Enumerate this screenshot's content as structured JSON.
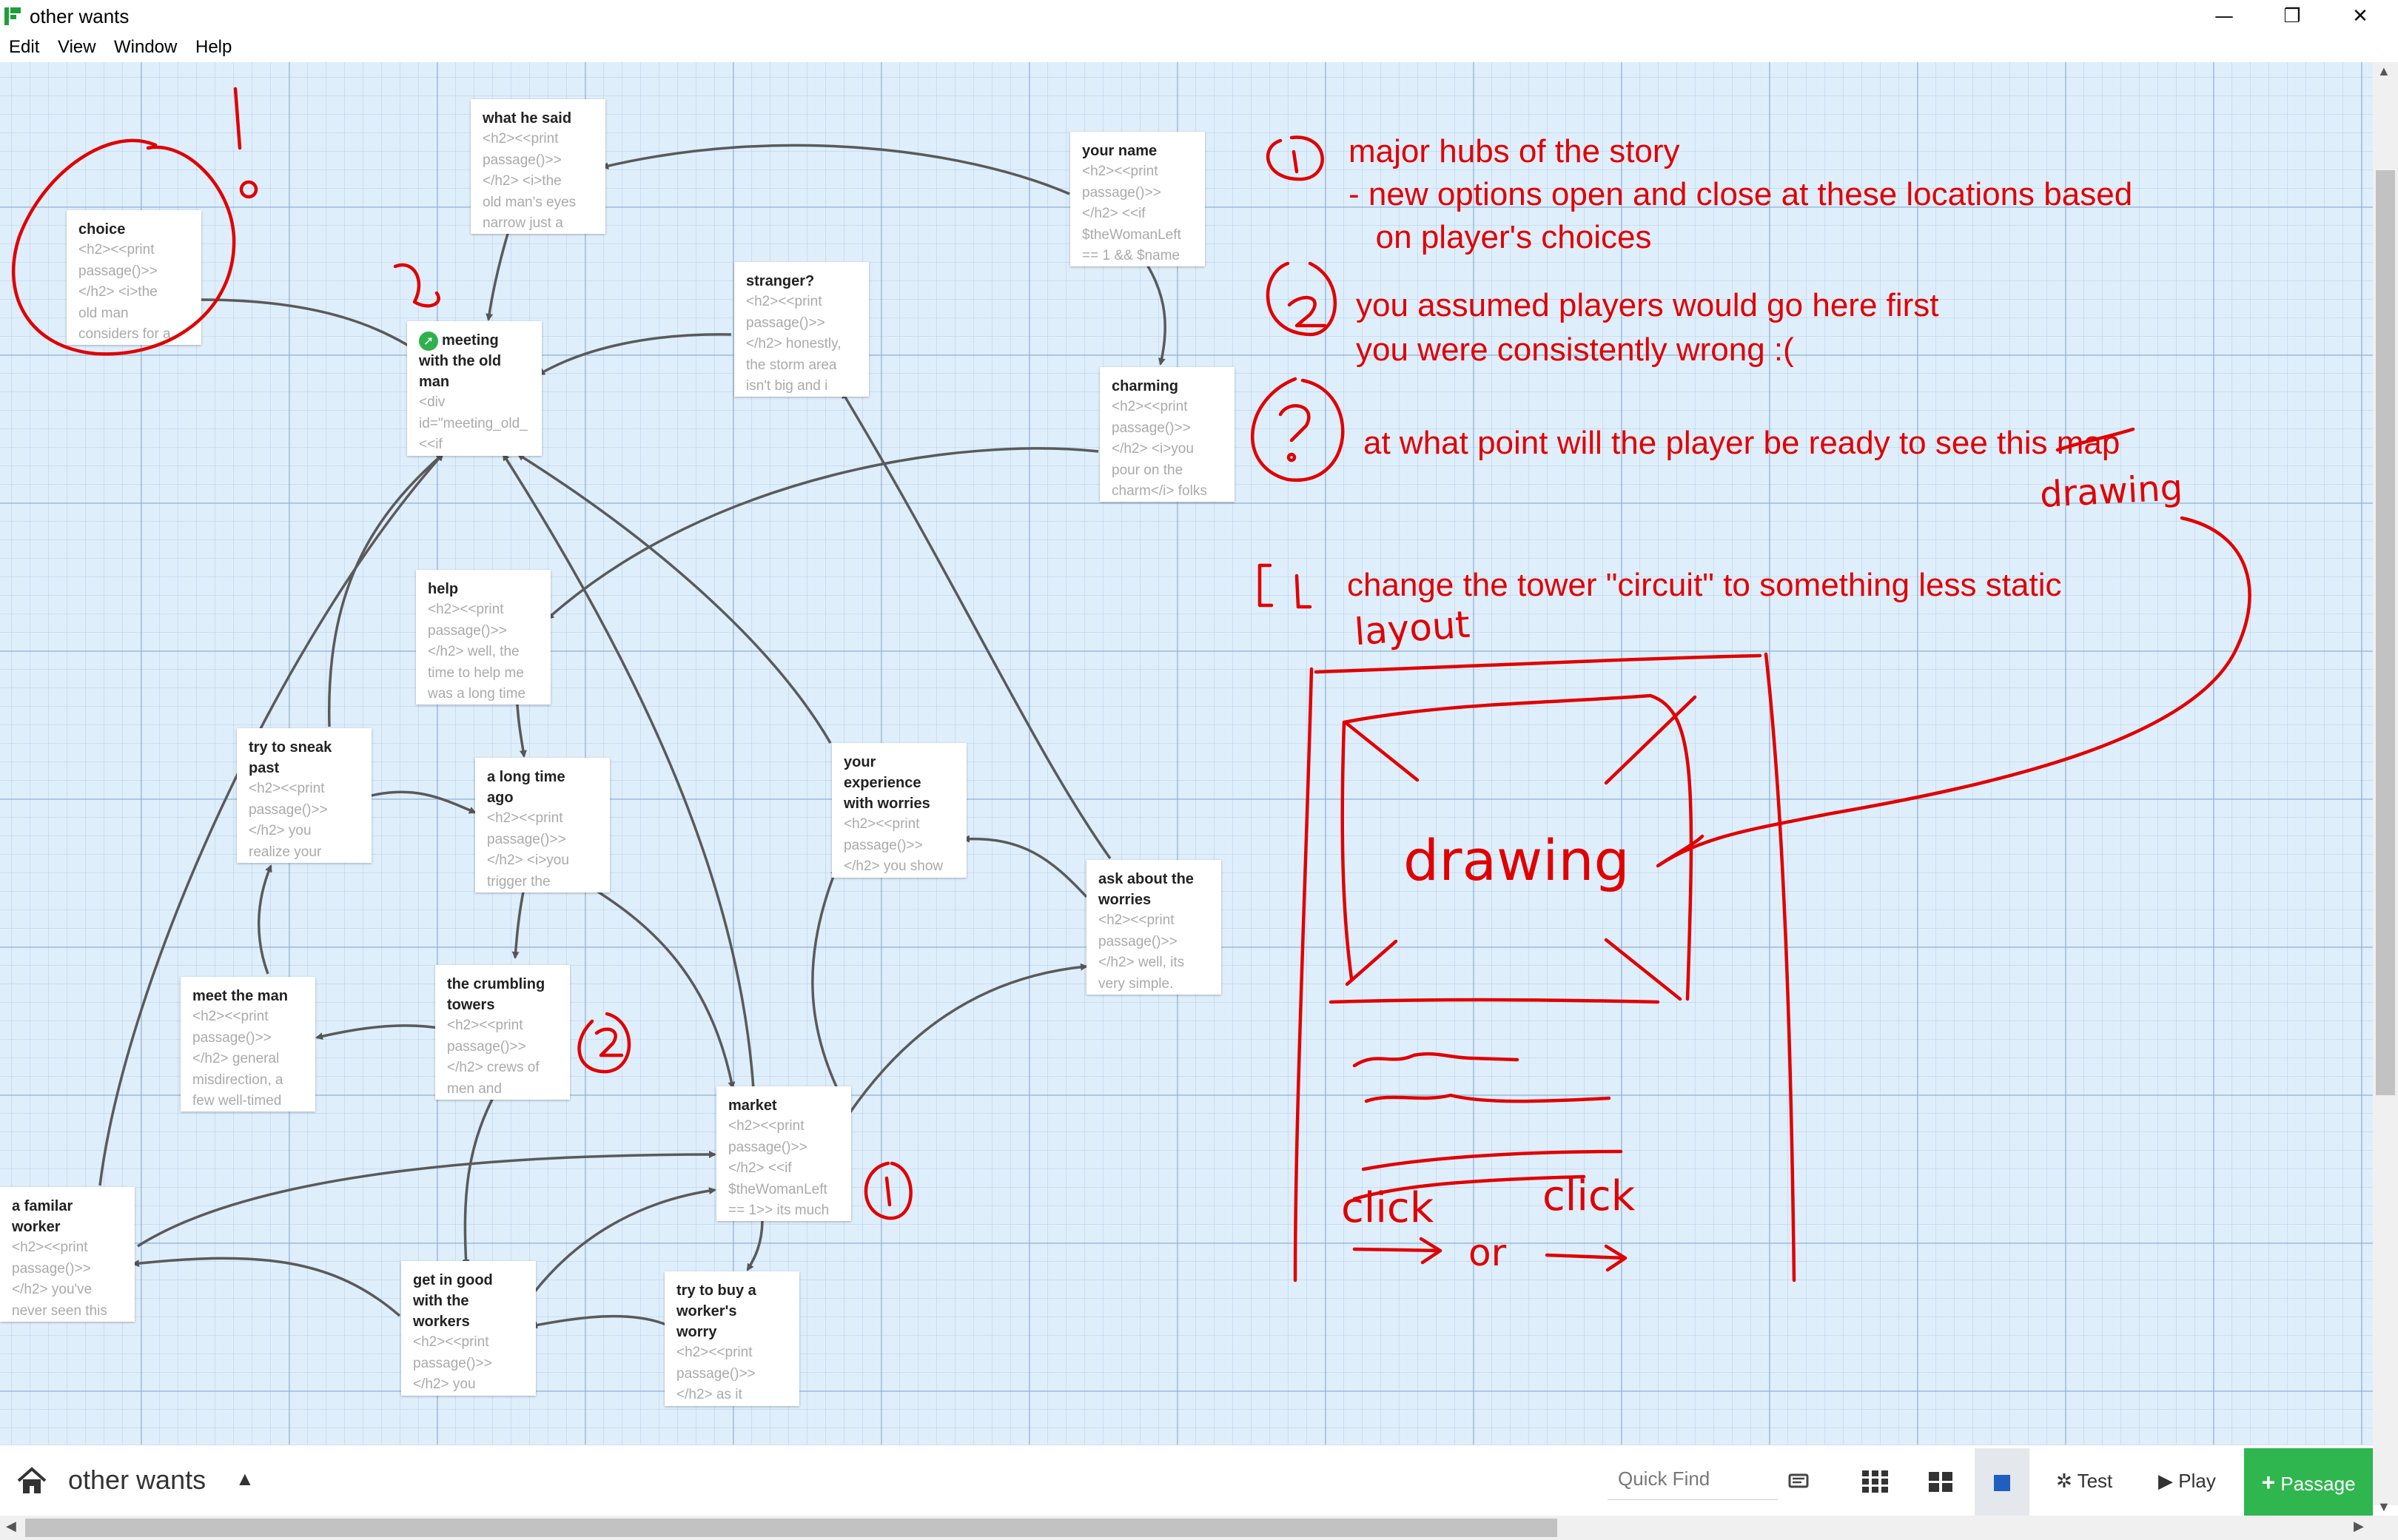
{
  "window": {
    "title": "other wants",
    "minimize": "—",
    "restore": "❐",
    "close": "✕"
  },
  "menu": [
    "Edit",
    "View",
    "Window",
    "Help"
  ],
  "passages": [
    {
      "id": "choice",
      "title": "choice",
      "excerpt": "<h2><<print\npassage()>>\n</h2> <i>the\nold man\nconsiders for a"
    },
    {
      "id": "what-he-said",
      "title": "what he said",
      "excerpt": "<h2><<print\npassage()>>\n</h2> <i>the\nold man's eyes\nnarrow just a"
    },
    {
      "id": "your-name",
      "title": "your name",
      "excerpt": "<h2><<print\npassage()>>\n</h2> <<if\n$theWomanLeft\n== 1 && $name"
    },
    {
      "id": "stranger",
      "title": "stranger?",
      "excerpt": "<h2><<print\npassage()>>\n</h2> honestly,\nthe storm area\nisn't big and i"
    },
    {
      "id": "meeting",
      "title": "meeting\nwith the old\nman",
      "excerpt": "<div\nid=\"meeting_old_\n<<if"
    },
    {
      "id": "charming",
      "title": "charming",
      "excerpt": "<h2><<print\npassage()>>\n</h2> <i>you\npour on the\ncharm</i> folks"
    },
    {
      "id": "help",
      "title": "help",
      "excerpt": "<h2><<print\npassage()>>\n</h2> well, the\ntime to help me\nwas a long time"
    },
    {
      "id": "sneak",
      "title": "try to sneak\npast",
      "excerpt": "<h2><<print\npassage()>>\n</h2> you\nrealize your"
    },
    {
      "id": "long-time",
      "title": "a long time\nago",
      "excerpt": "<h2><<print\npassage()>>\n</h2> <i>you\ntrigger the"
    },
    {
      "id": "experience",
      "title": "your\nexperience\nwith worries",
      "excerpt": "<h2><<print\npassage()>>\n</h2> you show"
    },
    {
      "id": "ask-worries",
      "title": "ask about the\nworries",
      "excerpt": "<h2><<print\npassage()>>\n</h2> well, its\nvery simple."
    },
    {
      "id": "meet-man",
      "title": "meet the man",
      "excerpt": "<h2><<print\npassage()>>\n</h2> general\nmisdirection, a\nfew well-timed"
    },
    {
      "id": "crumbling",
      "title": "the crumbling\ntowers",
      "excerpt": "<h2><<print\npassage()>>\n</h2> crews of\nmen and"
    },
    {
      "id": "market",
      "title": "market",
      "excerpt": "<h2><<print\npassage()>>\n</h2> <<if\n$theWomanLeft\n== 1>> its much"
    },
    {
      "id": "familiar",
      "title": "a familar\nworker",
      "excerpt": "<h2><<print\npassage()>>\n</h2> you've\nnever seen this"
    },
    {
      "id": "good-workers",
      "title": "get in good\nwith the\nworkers",
      "excerpt": "<h2><<print\npassage()>>\n</h2> you"
    },
    {
      "id": "buy-worry",
      "title": "try to buy a\nworker's\nworry",
      "excerpt": "<h2><<print\npassage()>>\n</h2> as it"
    }
  ],
  "annotations": {
    "hubs_line1": "major hubs of the story",
    "hubs_line2": "- new options open and close at these locations based",
    "hubs_line3": "   on player's choices",
    "assumed_line1": "you assumed players would go here first",
    "assumed_line2": "you were consistently wrong :(",
    "question": "at what point will the player be ready to see this map",
    "tower": "change the tower \"circuit\" to something less static",
    "handwritten": {
      "drawing_label": "drawing",
      "drawing_inner": "drawing",
      "layout": "layout",
      "click_left": "click",
      "click_right": "click",
      "or": "or"
    }
  },
  "bottom_bar": {
    "story_name": "other wants",
    "quick_find_placeholder": "Quick Find",
    "test": "Test",
    "play": "Play",
    "passage": "Passage"
  },
  "colors": {
    "accent_green": "#2fb64f",
    "annotation_red": "#e00000",
    "canvas_blue": "#dfeefb"
  }
}
